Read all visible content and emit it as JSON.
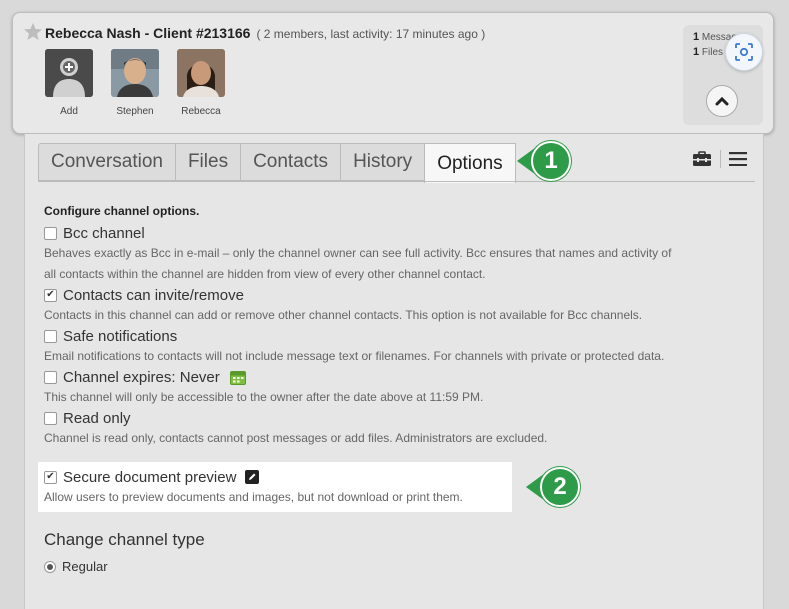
{
  "header": {
    "title": "Rebecca Nash - Client #213166",
    "meta": "( 2 members, last activity: 17 minutes ago )",
    "members": [
      {
        "label": "Add",
        "icon": "add-user-icon"
      },
      {
        "label": "Stephen",
        "icon": "avatar-photo"
      },
      {
        "label": "Rebecca",
        "icon": "avatar-photo"
      }
    ],
    "stats": {
      "messages_count": "1",
      "messages_label": "Messages",
      "files_count": "1",
      "files_label": "Files"
    }
  },
  "tabs": [
    {
      "label": "Conversation",
      "active": false
    },
    {
      "label": "Files",
      "active": false
    },
    {
      "label": "Contacts",
      "active": false
    },
    {
      "label": "History",
      "active": false
    },
    {
      "label": "Options",
      "active": true
    }
  ],
  "callouts": [
    "1",
    "2"
  ],
  "options": {
    "heading": "Configure channel options.",
    "items": [
      {
        "label": "Bcc channel",
        "checked": false,
        "description": "Behaves exactly as Bcc in e-mail – only the channel owner can see full activity. Bcc ensures that names and activity of",
        "description2": "all contacts within the channel are hidden from view of every other channel contact."
      },
      {
        "label": "Contacts can invite/remove",
        "checked": true,
        "description": "Contacts in this channel can add or remove other channel contacts. This option is not available for Bcc channels."
      },
      {
        "label": "Safe notifications",
        "checked": false,
        "description": "Email notifications to contacts will not include message text or filenames. For channels with private or protected data."
      },
      {
        "label": "Channel expires: Never",
        "checked": false,
        "description": "This channel will only be accessible to the owner after the date above at 11:59 PM."
      },
      {
        "label": "Read only",
        "checked": false,
        "description": "Channel is read only, contacts cannot post messages or add files. Administrators are excluded."
      },
      {
        "label": "Secure document preview",
        "checked": true,
        "description": "Allow users to preview documents and images, but not download or print them."
      }
    ]
  },
  "channel_type": {
    "heading": "Change channel type",
    "selected": "Regular"
  },
  "colors": {
    "callout_green": "#2e9b48"
  }
}
